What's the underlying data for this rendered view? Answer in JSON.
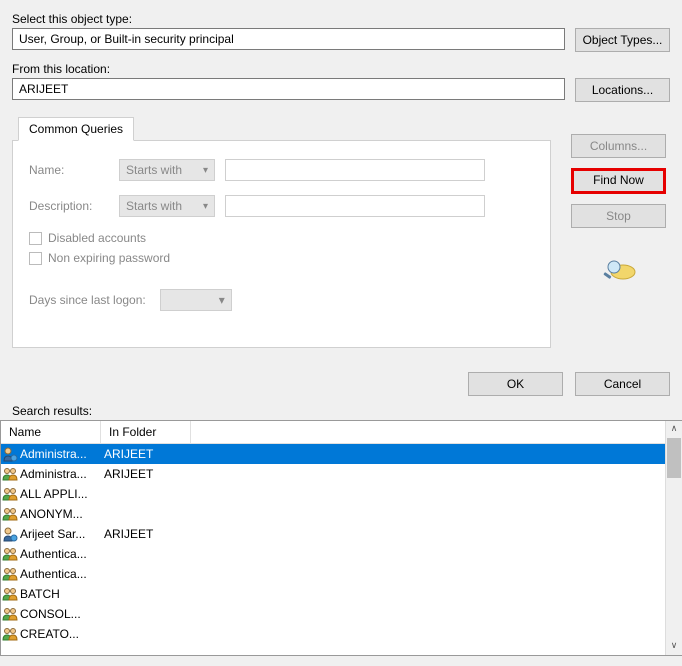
{
  "labels": {
    "select_object": "Select this object type:",
    "from_location": "From this location:",
    "search_results": "Search results:"
  },
  "fields": {
    "object_type": "User, Group, or Built-in security principal",
    "location": "ARIJEET"
  },
  "buttons": {
    "object_types": "Object Types...",
    "locations": "Locations...",
    "columns": "Columns...",
    "find_now": "Find Now",
    "stop": "Stop",
    "ok": "OK",
    "cancel": "Cancel"
  },
  "tab": {
    "title": "Common Queries",
    "name_label": "Name:",
    "desc_label": "Description:",
    "starts_with": "Starts with",
    "disabled_accounts": "Disabled accounts",
    "non_expiring": "Non expiring password",
    "days_since": "Days since last logon:"
  },
  "results": {
    "headers": {
      "name": "Name",
      "folder": "In Folder"
    },
    "rows": [
      {
        "icon": "user",
        "name": "Administra...",
        "folder": "ARIJEET",
        "selected": true
      },
      {
        "icon": "group",
        "name": "Administra...",
        "folder": "ARIJEET"
      },
      {
        "icon": "group",
        "name": "ALL APPLI...",
        "folder": ""
      },
      {
        "icon": "group",
        "name": "ANONYM...",
        "folder": ""
      },
      {
        "icon": "user",
        "name": "Arijeet Sar...",
        "folder": "ARIJEET"
      },
      {
        "icon": "group",
        "name": "Authentica...",
        "folder": ""
      },
      {
        "icon": "group",
        "name": "Authentica...",
        "folder": ""
      },
      {
        "icon": "group",
        "name": "BATCH",
        "folder": ""
      },
      {
        "icon": "group",
        "name": "CONSOL...",
        "folder": ""
      },
      {
        "icon": "group",
        "name": "CREATO...",
        "folder": ""
      }
    ]
  }
}
